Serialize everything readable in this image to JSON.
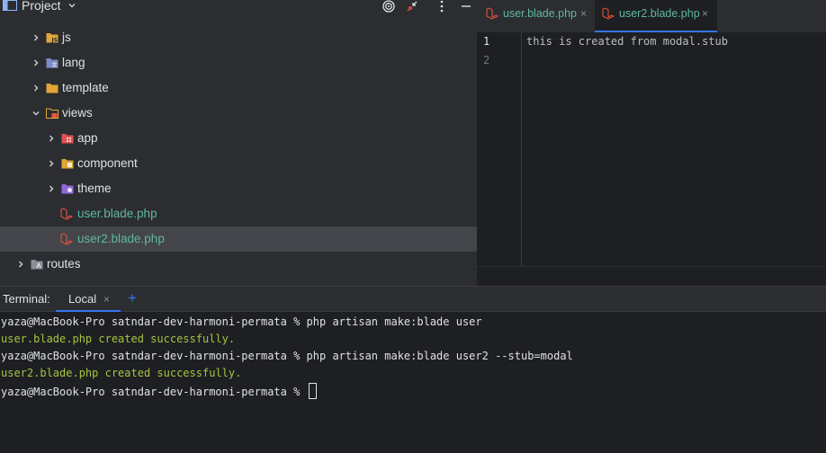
{
  "project_panel": {
    "title": "Project",
    "tree": [
      {
        "label": "js",
        "type": "folder",
        "expanded": false,
        "icon": "js-folder-icon"
      },
      {
        "label": "lang",
        "type": "folder",
        "expanded": false,
        "icon": "lang-folder-icon"
      },
      {
        "label": "template",
        "type": "folder",
        "expanded": false,
        "icon": "folder-icon"
      },
      {
        "label": "views",
        "type": "folder",
        "expanded": true,
        "icon": "views-folder-icon"
      },
      {
        "label": "app",
        "type": "folder",
        "expanded": false,
        "icon": "app-folder-icon"
      },
      {
        "label": "component",
        "type": "folder",
        "expanded": false,
        "icon": "component-folder-icon"
      },
      {
        "label": "theme",
        "type": "folder",
        "expanded": false,
        "icon": "theme-folder-icon"
      },
      {
        "label": "user.blade.php",
        "type": "file",
        "icon": "blade-file-icon"
      },
      {
        "label": "user2.blade.php",
        "type": "file",
        "icon": "blade-file-icon",
        "selected": true
      },
      {
        "label": "routes",
        "type": "folder",
        "expanded": false,
        "icon": "routes-folder-icon"
      }
    ]
  },
  "editor": {
    "tabs": [
      {
        "label": "user.blade.php",
        "close": "×",
        "active": false
      },
      {
        "label": "user2.blade.php",
        "close": "×",
        "active": true
      }
    ],
    "lines": [
      {
        "number": "1",
        "text": "this is created from modal.stub"
      },
      {
        "number": "2",
        "text": ""
      }
    ]
  },
  "terminal": {
    "title": "Terminal:",
    "tab_label": "Local",
    "tab_close": "×",
    "add_label": "+",
    "lines": [
      {
        "text": "yaza@MacBook-Pro satndar-dev-harmoni-permata % php artisan make:blade user",
        "kind": "command"
      },
      {
        "text": "user.blade.php created successfully.",
        "kind": "success"
      },
      {
        "text": "yaza@MacBook-Pro satndar-dev-harmoni-permata % php artisan make:blade user2 --stub=modal",
        "kind": "command"
      },
      {
        "text": "user2.blade.php created successfully.",
        "kind": "success"
      },
      {
        "text": "yaza@MacBook-Pro satndar-dev-harmoni-permata % ",
        "kind": "prompt"
      }
    ]
  },
  "colors": {
    "accent": "#3574f0",
    "blade_file": "#5fb8a0",
    "success_text": "#a8c23f",
    "laravel_red": "#f05340"
  }
}
